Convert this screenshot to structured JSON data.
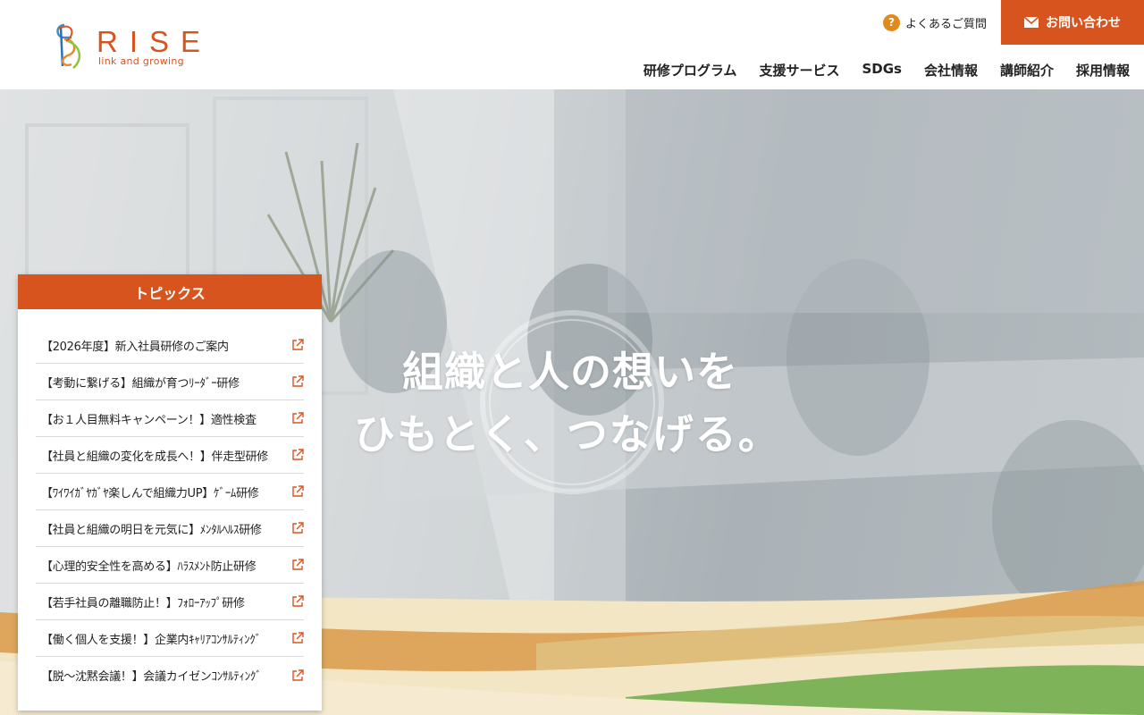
{
  "brand": {
    "name": "RISE",
    "tagline": "link and growing",
    "accent_color": "#d8541f",
    "faq_icon_color": "#e08a1d"
  },
  "header": {
    "faq_icon_glyph": "?",
    "faq_label": "よくあるご質問",
    "contact_label": "お問い合わせ",
    "nav": [
      {
        "label": "研修プログラム"
      },
      {
        "label": "支援サービス"
      },
      {
        "label": "SDGs"
      },
      {
        "label": "会社情報"
      },
      {
        "label": "講師紹介"
      },
      {
        "label": "採用情報"
      }
    ]
  },
  "hero": {
    "catch_line1": "組織と人の想いを",
    "catch_line2": "ひもとく、つなげる。"
  },
  "topics": {
    "title": "トピックス",
    "items": [
      {
        "label": "【2026年度】新入社員研修のご案内"
      },
      {
        "label": "【考動に繋げる】組織が育つﾘｰﾀﾞｰ研修"
      },
      {
        "label": "【お１人目無料キャンペーン！】適性検査"
      },
      {
        "label": "【社員と組織の変化を成長へ！】伴走型研修"
      },
      {
        "label": "【ﾜｲﾜｲｶﾞﾔｶﾞﾔ楽しんで組織力UP】ｹﾞｰﾑ研修"
      },
      {
        "label": "【社員と組織の明日を元気に】ﾒﾝﾀﾙﾍﾙｽ研修"
      },
      {
        "label": "【心理的安全性を高める】ﾊﾗｽﾒﾝﾄ防止研修"
      },
      {
        "label": "【若手社員の離職防止！】ﾌｫﾛｰｱｯﾌﾟ研修"
      },
      {
        "label": "【働く個人を支援！】企業内ｷｬﾘｱｺﾝｻﾙﾃｨﾝｸﾞ"
      },
      {
        "label": "【脱～沈黙会議！】会議カイゼンｺﾝｻﾙﾃｨﾝｸﾞ"
      }
    ]
  }
}
